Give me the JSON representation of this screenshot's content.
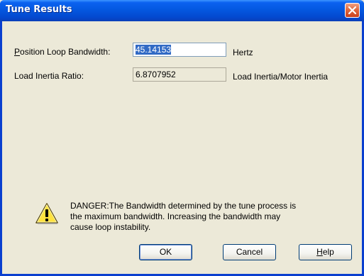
{
  "window": {
    "title": "Tune Results",
    "close_icon": "close-icon"
  },
  "fields": {
    "bandwidth": {
      "label_underlined": "P",
      "label_rest": "osition Loop Bandwidth:",
      "value": "45.14153",
      "unit": "Hertz"
    },
    "inertia": {
      "label": "Load Inertia Ratio:",
      "value": "6.8707952",
      "unit": "Load Inertia/Motor Inertia"
    }
  },
  "warning": {
    "icon": "warning-icon",
    "line1": "DANGER:The Bandwidth determined by the tune process is",
    "line2": "the maximum bandwidth. Increasing the bandwidth may",
    "line3": "cause loop instability."
  },
  "buttons": {
    "ok": "OK",
    "cancel": "Cancel",
    "help_underlined": "H",
    "help_rest": "elp"
  },
  "colors": {
    "titlebar": "#0458e0",
    "dialog_bg": "#ece9d8",
    "close_button": "#e06a3f",
    "selection": "#316ac5"
  }
}
